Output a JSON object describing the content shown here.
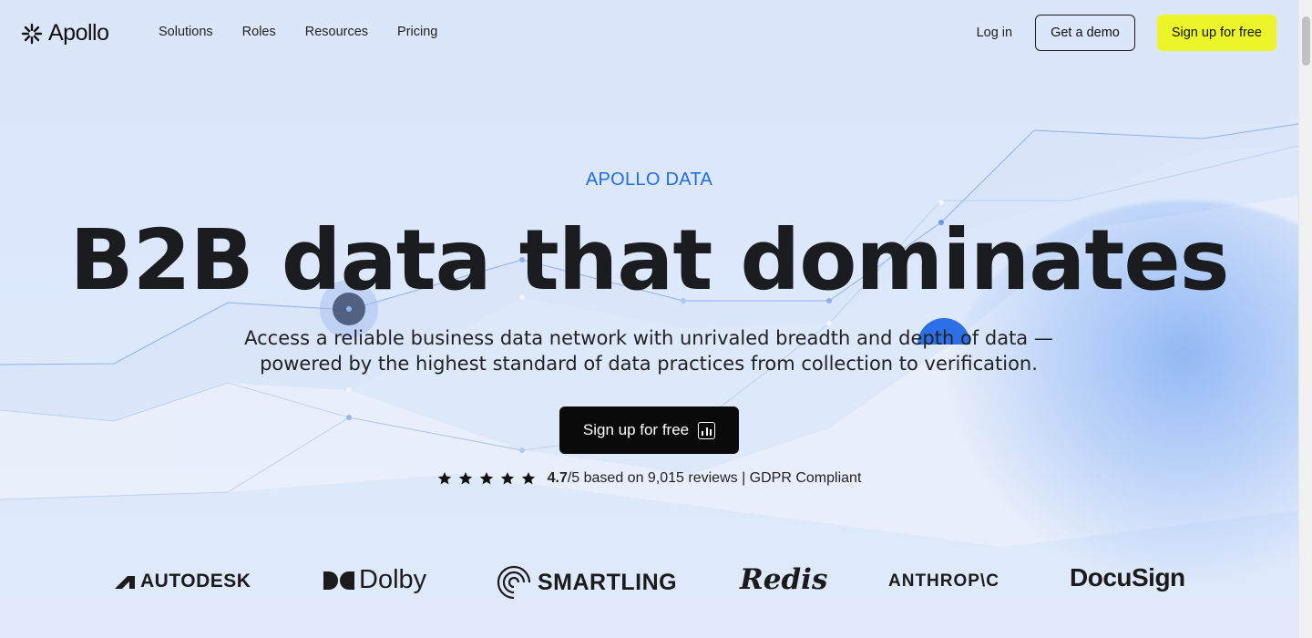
{
  "nav": {
    "logo_text": "Apollo",
    "links": [
      "Solutions",
      "Roles",
      "Resources",
      "Pricing"
    ],
    "login_label": "Log in",
    "demo_label": "Get a demo",
    "signup_label": "Sign up for free"
  },
  "hero": {
    "eyebrow": "APOLLO DATA",
    "headline": "B2B data that dominates",
    "subhead_line1": "Access a reliable business data network with unrivaled breadth and depth of data —",
    "subhead_line2": "powered by the highest standard of data practices from collection to verification.",
    "cta_label": "Sign up for free",
    "rating": {
      "stars": 5,
      "score": "4.7",
      "suffix": "/5 based on 9,015 reviews | GDPR Compliant"
    }
  },
  "logos": [
    "AUTODESK",
    "Dolby",
    "SMARTLING",
    "Redis",
    "ANTHROP\\C",
    "DocuSign"
  ],
  "colors": {
    "accent_blue": "#1f6ee8",
    "signup_yellow": "#ebf529",
    "cta_black": "#0a0a0a",
    "background": "#dde8fb"
  },
  "icons": {
    "logo": "apollo-asterisk-icon",
    "cta": "bar-chart-icon",
    "rating": "star-icon"
  }
}
